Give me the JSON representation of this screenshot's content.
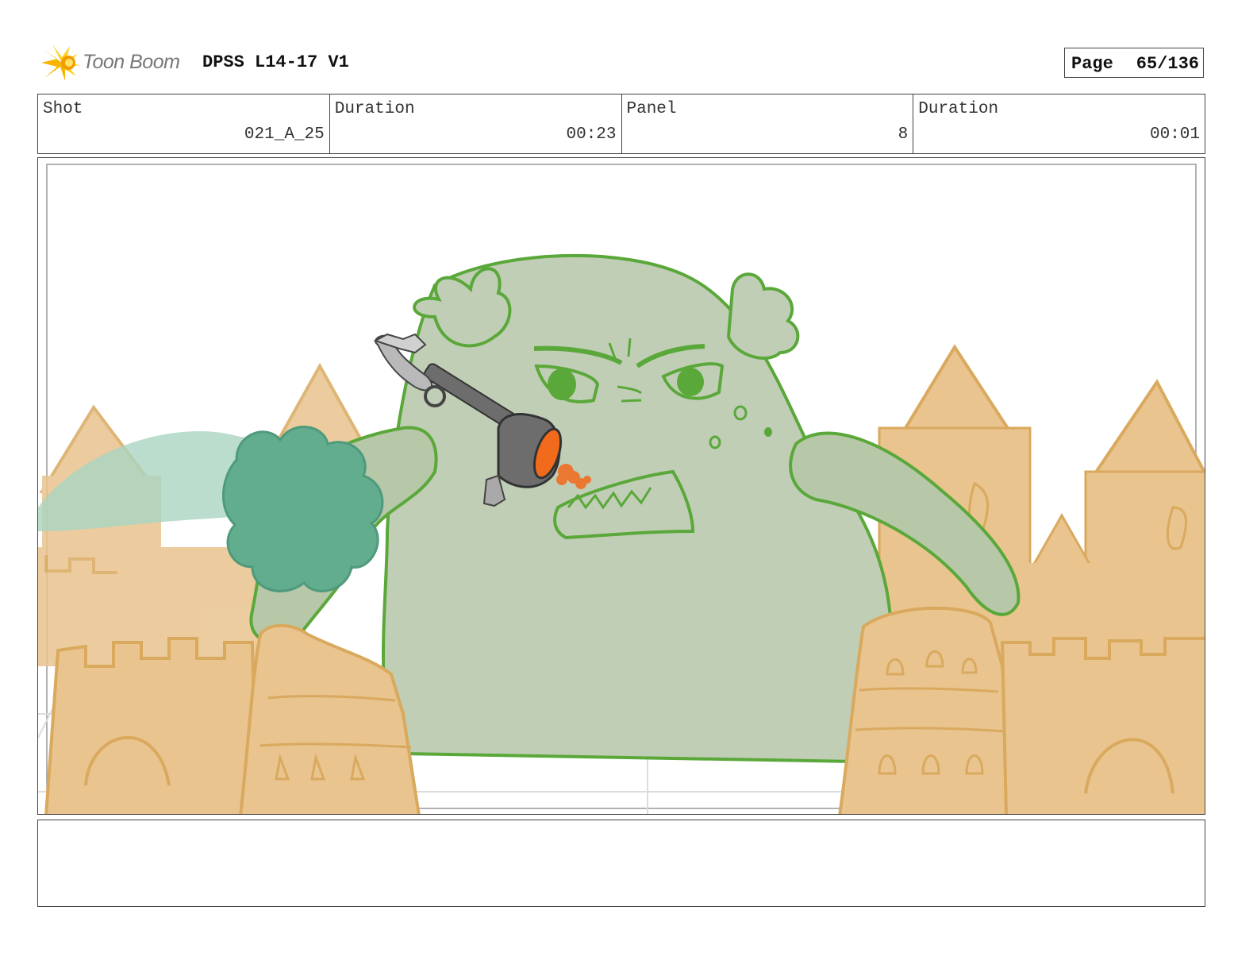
{
  "header": {
    "brand": "Toon Boom",
    "project_title": "DPSS L14-17 V1",
    "page_label": "Page",
    "page_value": "65/136"
  },
  "info": {
    "shot_label": "Shot",
    "shot_value": "021_A_25",
    "shot_duration_label": "Duration",
    "shot_duration_value": "00:23",
    "panel_label": "Panel",
    "panel_value": "8",
    "panel_duration_label": "Duration",
    "panel_duration_value": "00:01"
  },
  "colors": {
    "monster_fill": "#c1ceb6",
    "monster_line": "#5aa83a",
    "sand": "#e9c48f",
    "sand_line": "#d9a95e",
    "puff": "#62ad8e",
    "flame": "#f26a1b",
    "weapon": "#6d6d6d"
  },
  "notes": ""
}
